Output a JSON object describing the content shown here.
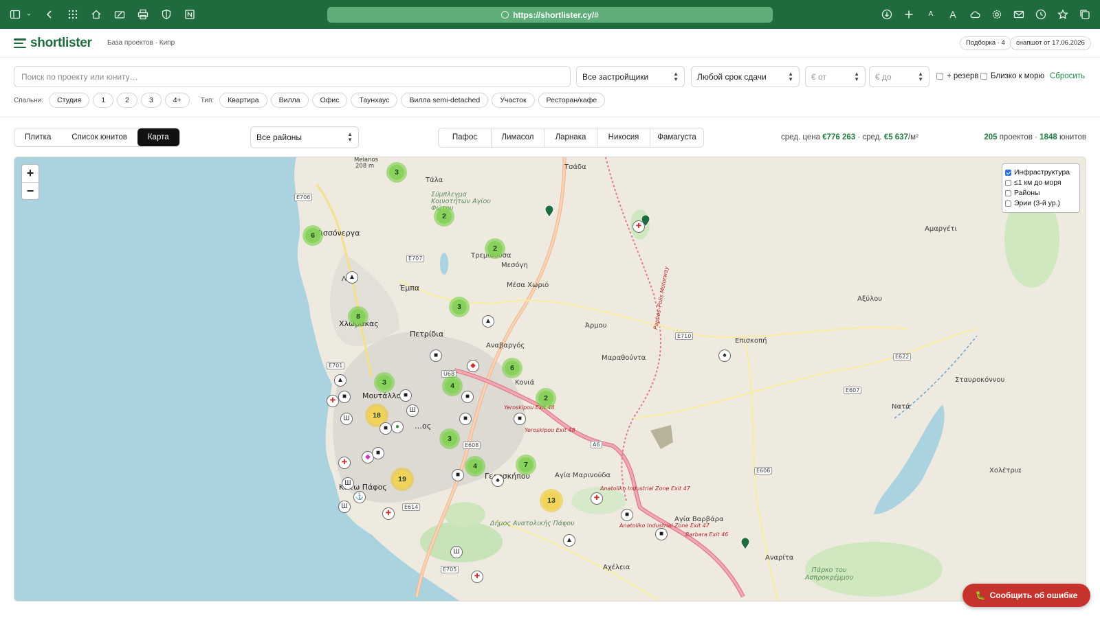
{
  "browser": {
    "url": "https://shortlister.cy/#",
    "left_icons": [
      "sidebar-icon",
      "chevron-down-icon",
      "back-icon",
      "grid-icon",
      "home-icon",
      "edit-icon",
      "printer-icon",
      "shield-icon",
      "notion-icon"
    ],
    "right_icons": [
      "download-icon",
      "plus-icon",
      "text-smaller-icon",
      "text-larger-icon",
      "cloud-icon",
      "settings-icon",
      "mail-icon",
      "history-icon",
      "star-icon",
      "tabs-icon"
    ],
    "text_small": "A",
    "text_large": "A"
  },
  "header": {
    "logo": "shortlister",
    "breadcrumb": "База проектов · Кипр",
    "selection": "Подборка · 4",
    "snapshot": "снапшот от 17.06.2026"
  },
  "filters": {
    "search_placeholder": "Поиск по проекту или юниту…",
    "developer": "Все застройщики",
    "delivery": "Любой срок сдачи",
    "price_from": "€ от",
    "price_to": "€ до",
    "reserve": "+ резерв",
    "near_sea": "Близко к морю",
    "reset": "Сбросить",
    "bedrooms_label": "Спальни:",
    "bedrooms": [
      "Студия",
      "1",
      "2",
      "3",
      "4+"
    ],
    "type_label": "Тип:",
    "types": [
      "Квартира",
      "Вилла",
      "Офис",
      "Таунхаус",
      "Вилла semi-detached",
      "Участок",
      "Ресторан/кафе"
    ]
  },
  "view": {
    "tabs": [
      "Плитка",
      "Список юнитов",
      "Карта"
    ],
    "active_tab": "Карта",
    "district": "Все районы",
    "cities": [
      "Пафос",
      "Лимасол",
      "Ларнака",
      "Никосия",
      "Фамагуста"
    ],
    "avg_price_label": "сред. цена",
    "avg_price": "€776 263",
    "avg_sqm_label": "· сред.",
    "avg_sqm": "€5 637",
    "avg_sqm_unit": "/м²",
    "projects_count": "205",
    "projects_label": "проектов ·",
    "units_count": "1848",
    "units_label": "юнитов"
  },
  "map": {
    "zoom_in": "+",
    "zoom_out": "−",
    "layers": [
      {
        "label": "Инфраструктура",
        "checked": true
      },
      {
        "label": "≤1 км до моря",
        "checked": false
      },
      {
        "label": "Районы",
        "checked": false
      },
      {
        "label": "Эрии (3-й ур.)",
        "checked": false
      }
    ],
    "clusters": [
      "3",
      "2",
      "6",
      "2",
      "3",
      "8",
      "6",
      "3",
      "4",
      "2",
      "18",
      "3",
      "4",
      "7",
      "19",
      "13"
    ],
    "places": {
      "melanos": "Melanos",
      "melanos_elev": "208 m",
      "tala": "Τάλα",
      "tsada": "Τσάδα",
      "kissonerga": "Κισσόνεργα",
      "emba": "Έμπα",
      "trimithousa": "Τρεμιθούσα",
      "mesogi": "Μεσόγη",
      "mesa_chorio": "Μέσα Χωριό",
      "chlorakas": "Χλώρακας",
      "petridia": "Πετρίδια",
      "anavargos": "Αναβαργός",
      "armou": "Άρμου",
      "marathounta": "Μαραθούντα",
      "episkopi": "Επισκοπή",
      "koloni": "Κονιά",
      "moutallos": "Μουτάλλος",
      "pafos_town": "…ος",
      "geroskipou": "Γεροσκήπου",
      "agia_marinouda": "Αγία Μαρινούδα",
      "kato_pafos": "Κάτω Πάφος",
      "agia_varvara": "Αγία Βαρβάρα",
      "acheleia": "Αχέλεια",
      "anarita": "Αναρίτα",
      "amargeti": "Αμαργέτι",
      "axylou": "Αξύλου",
      "stavrokonnou": "Σταυροκόννου",
      "nata": "Νατά",
      "choletria": "Χολέτρια",
      "le": "Λέ",
      "area_community": "Σύμπλεγμα Κοινοτήτων Αγίου Φώτου",
      "area_municipality": "Δήμος Ανατολικής Πάφου",
      "area_park": "Πάρκο του Ασπροκρέμμου"
    },
    "roads": [
      "E706",
      "E707",
      "E701",
      "U68",
      "E710",
      "E622",
      "E607",
      "E606",
      "A6",
      "E614",
      "E705",
      "E608"
    ],
    "exits": [
      "Yeroskipou Exit 48",
      "Yeroskipou Exit 48",
      "Anatoliko Industrial Zone Exit 47",
      "Anatoliko Industrial Zone Exit 47",
      "Barbara Exit 46"
    ],
    "motorway_label": "Paphos–Polis Motorway"
  },
  "report": {
    "label": "Сообщить об ошибке"
  },
  "colors": {
    "brand": "#1f6b3d",
    "accent_green": "#1f8a4a",
    "report": "#c6332c",
    "sea": "#aad3df"
  }
}
